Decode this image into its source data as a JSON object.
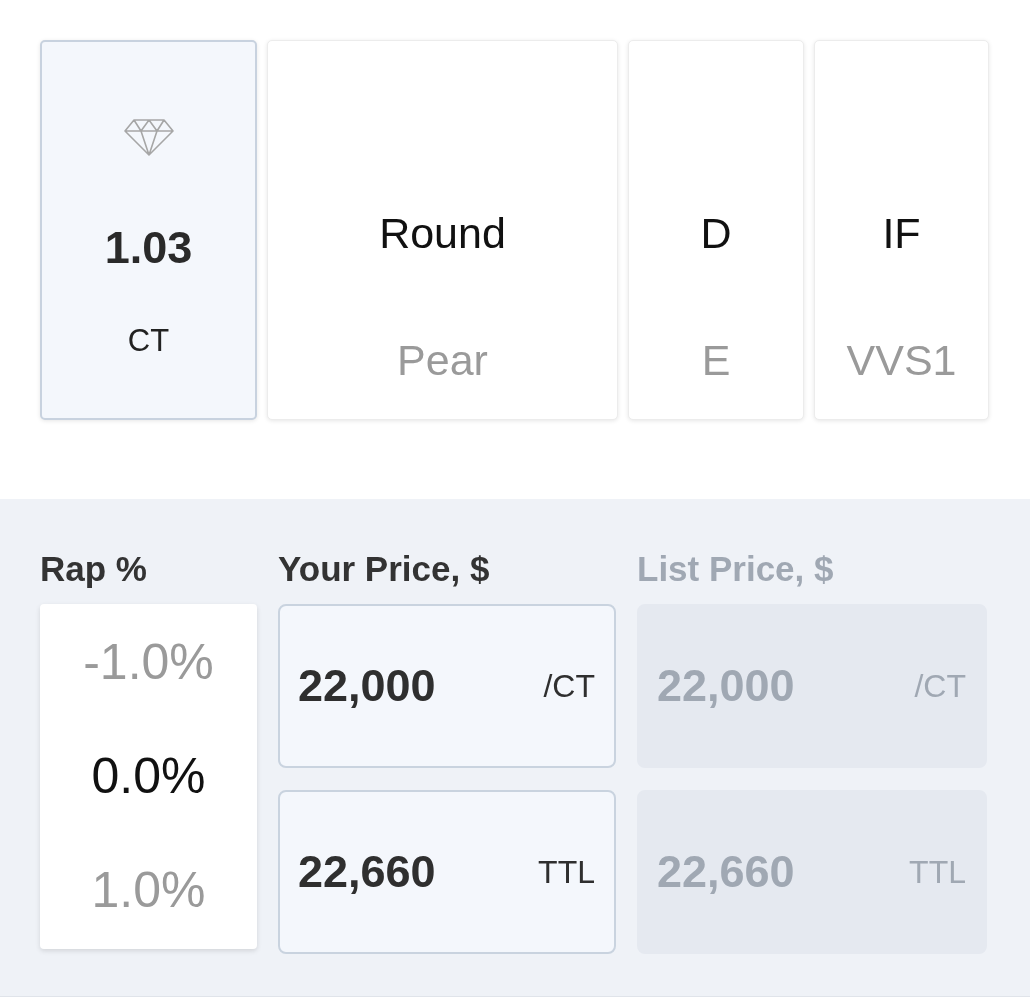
{
  "spec_cards": [
    {
      "kind": "carat",
      "selected": true,
      "value": "1.03",
      "unit": "CT"
    },
    {
      "kind": "picker",
      "selected": false,
      "options": [
        {
          "label": "Round",
          "selected": true
        },
        {
          "label": "Pear",
          "selected": false
        }
      ]
    },
    {
      "kind": "picker",
      "selected": false,
      "options": [
        {
          "label": "D",
          "selected": true
        },
        {
          "label": "E",
          "selected": false
        }
      ]
    },
    {
      "kind": "picker",
      "selected": false,
      "options": [
        {
          "label": "IF",
          "selected": true
        },
        {
          "label": "VVS1",
          "selected": false
        }
      ]
    }
  ],
  "pricing": {
    "rap": {
      "label": "Rap %",
      "options": [
        {
          "label": "-1.0%",
          "selected": false
        },
        {
          "label": "0.0%",
          "selected": true
        },
        {
          "label": "1.0%",
          "selected": false
        }
      ]
    },
    "price_groups": [
      {
        "label": "Your Price, $",
        "disabled": false,
        "fields": [
          {
            "value": "22,000",
            "unit": "/CT"
          },
          {
            "value": "22,660",
            "unit": "TTL"
          }
        ]
      },
      {
        "label": "List Price, $",
        "disabled": true,
        "fields": [
          {
            "value": "22,000",
            "unit": "/CT"
          },
          {
            "value": "22,660",
            "unit": "TTL"
          }
        ]
      }
    ]
  }
}
